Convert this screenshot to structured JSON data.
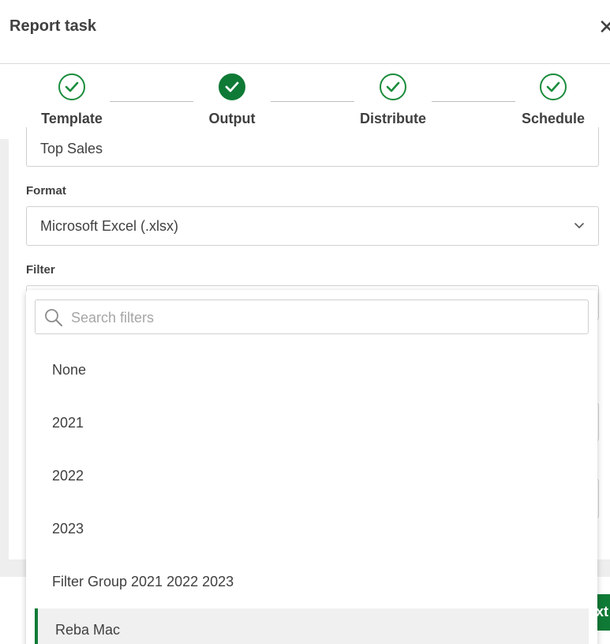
{
  "header": {
    "title": "Report task",
    "close_label": "✕"
  },
  "stepper": {
    "steps": [
      {
        "label": "Template",
        "state": "done"
      },
      {
        "label": "Output",
        "state": "active"
      },
      {
        "label": "Distribute",
        "state": "done"
      },
      {
        "label": "Schedule",
        "state": "done"
      }
    ]
  },
  "form": {
    "name_value": "Top Sales",
    "format_label": "Format",
    "format_value": "Microsoft Excel (.xlsx)",
    "filter_label": "Filter"
  },
  "filter_dropdown": {
    "search_placeholder": "Search filters",
    "options": [
      "None",
      "2021",
      "2022",
      "2023",
      "Filter Group 2021 2022 2023",
      "Reba Mac"
    ],
    "selected": "Reba Mac"
  },
  "footer": {
    "next_label": "Next"
  },
  "colors": {
    "accent": "#0f7a36",
    "check": "#1a8c3c",
    "panel_bg": "#eeeeee"
  }
}
